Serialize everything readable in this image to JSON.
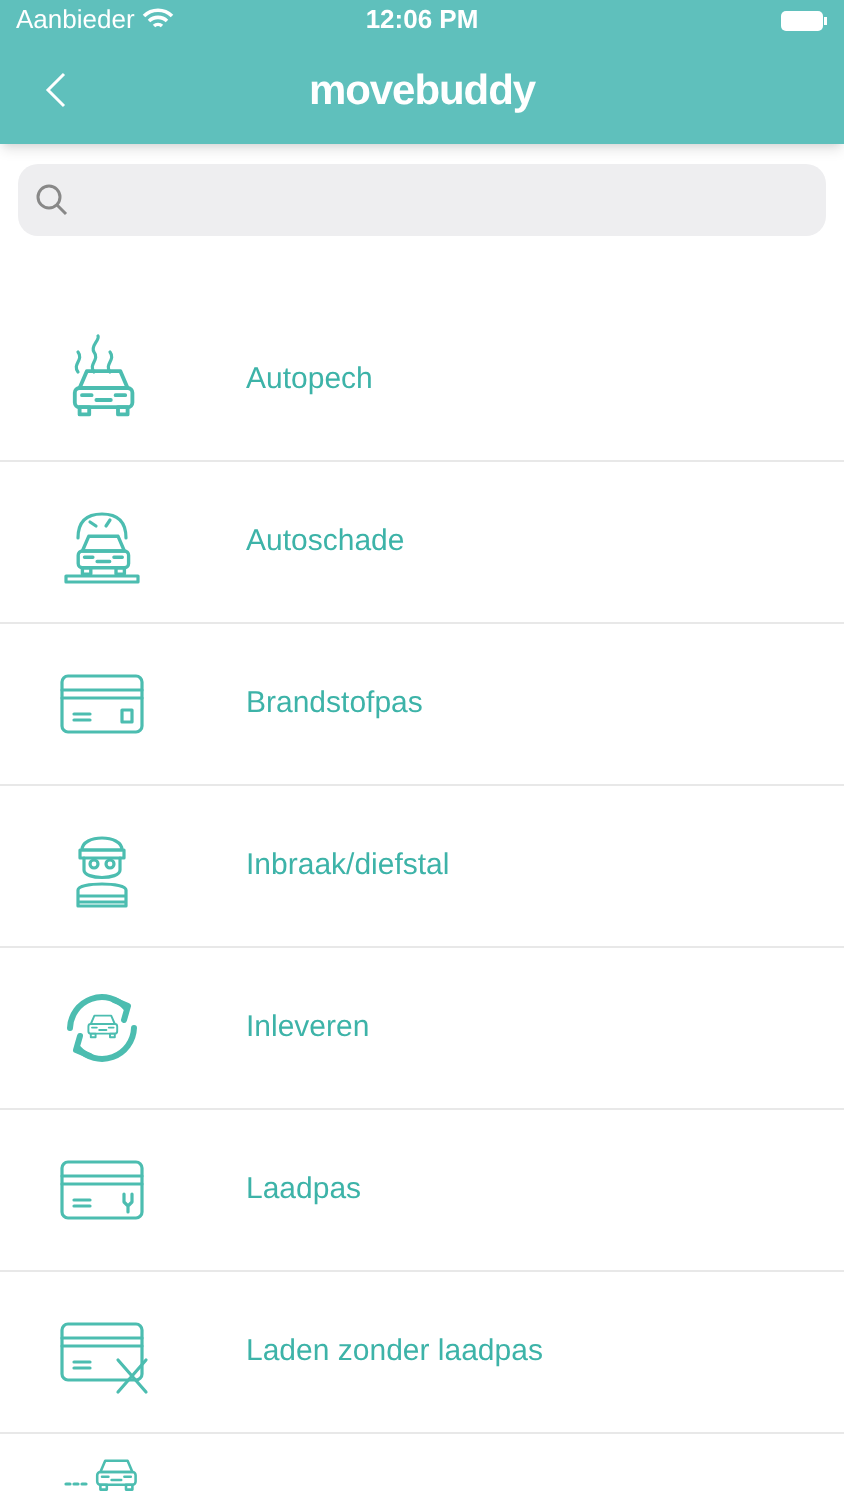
{
  "status_bar": {
    "carrier": "Aanbieder",
    "time": "12:06 PM"
  },
  "header": {
    "logo": "movebuddy"
  },
  "items": [
    {
      "kind": "car-smoke",
      "label": "Autopech"
    },
    {
      "kind": "car-crash",
      "label": "Autoschade"
    },
    {
      "kind": "card",
      "label": "Brandstofpas"
    },
    {
      "kind": "thief",
      "label": "Inbraak/diefstal"
    },
    {
      "kind": "car-cycle",
      "label": "Inleveren"
    },
    {
      "kind": "card-plug",
      "label": "Laadpas"
    },
    {
      "kind": "card-cross",
      "label": "Laden zonder laadpas"
    },
    {
      "kind": "car-route"
    }
  ]
}
